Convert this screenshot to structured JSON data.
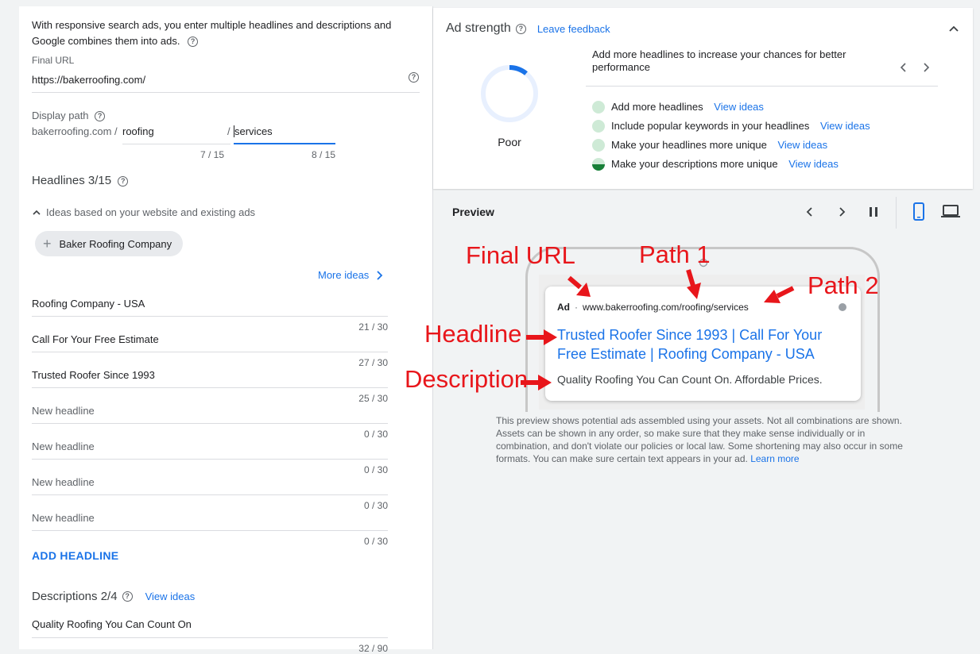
{
  "intro_text": "With responsive search ads, you enter multiple headlines and descriptions and Google combines them into ads.",
  "final_url": {
    "label": "Final URL",
    "value": "https://bakerroofing.com/"
  },
  "display_path": {
    "label": "Display path",
    "domain": "bakerroofing.com /",
    "path1": "roofing",
    "separator": "/",
    "path2": "services",
    "path1_count": "7 / 15",
    "path2_count": "8 / 15"
  },
  "headlines": {
    "title": "Headlines 3/15",
    "ideas_label": "Ideas based on your website and existing ads",
    "idea_chip": "Baker Roofing Company",
    "more_ideas": "More ideas",
    "items": [
      {
        "value": "Roofing Company - USA",
        "count": "21 / 30"
      },
      {
        "value": "Call For Your Free Estimate",
        "count": "27 / 30"
      },
      {
        "value": "Trusted Roofer Since 1993",
        "count": "25 / 30"
      },
      {
        "value": "New headline",
        "count": "0 / 30"
      },
      {
        "value": "New headline",
        "count": "0 / 30"
      },
      {
        "value": "New headline",
        "count": "0 / 30"
      },
      {
        "value": "New headline",
        "count": "0 / 30"
      }
    ],
    "add_label": "ADD HEADLINE"
  },
  "descriptions": {
    "title": "Descriptions 2/4",
    "view_ideas": "View ideas",
    "first_value": "Quality Roofing You Can Count On",
    "first_count": "32 / 90"
  },
  "ad_strength": {
    "title": "Ad strength",
    "leave_feedback": "Leave feedback",
    "rating": "Poor",
    "tip": "Add more headlines to increase your chances for better performance",
    "suggestions": [
      {
        "text": "Add more headlines",
        "link": "View ideas"
      },
      {
        "text": "Include popular keywords in your headlines",
        "link": "View ideas"
      },
      {
        "text": "Make your headlines more unique",
        "link": "View ideas"
      },
      {
        "text": "Make your descriptions more unique",
        "link": "View ideas"
      }
    ]
  },
  "preview": {
    "title": "Preview",
    "ad_badge": "Ad",
    "ad_url": "www.bakerroofing.com/roofing/services",
    "ad_headline_1": "Trusted Roofer Since 1993 | Call For Your",
    "ad_headline_2": "Free Estimate | Roofing Company - USA",
    "ad_description": "Quality Roofing You Can Count On. Affordable Prices.",
    "disclaimer": "This preview shows potential ads assembled using your assets. Not all combinations are shown. Assets can be shown in any order, so make sure that they make sense individually or in combination, and don't violate our policies or local law. Some shortening may also occur in some formats. You can make sure certain text appears in your ad.",
    "learn_more": "Learn more"
  },
  "annotations": {
    "final_url": "Final URL",
    "path1": "Path 1",
    "path2": "Path 2",
    "headline": "Headline",
    "description": "Description"
  },
  "colors": {
    "accent": "#1a73e8",
    "annotation": "#e8161b",
    "success": "#188038"
  }
}
